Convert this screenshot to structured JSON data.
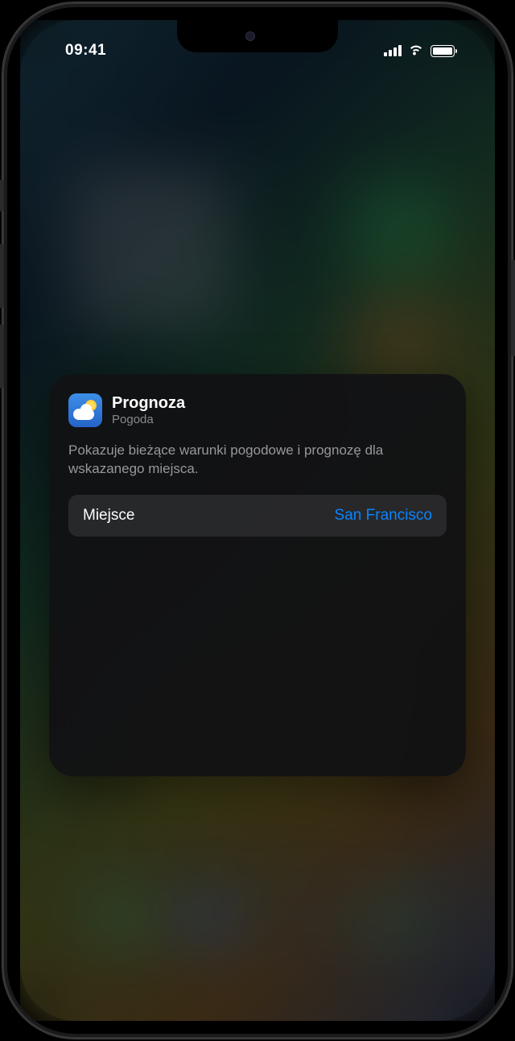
{
  "status_bar": {
    "time": "09:41"
  },
  "widget_edit": {
    "title": "Prognoza",
    "app_name": "Pogoda",
    "description": "Pokazuje bieżące warunki pogodowe i prognozę dla wskazanego miejsca.",
    "setting": {
      "label": "Miejsce",
      "value": "San Francisco"
    }
  }
}
